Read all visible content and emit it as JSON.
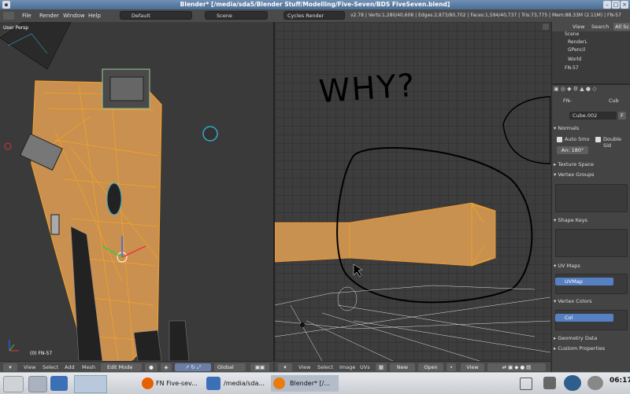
{
  "window": {
    "title": "Blender* [/media/sda5/Blender Stuff/Modelling/Five-Seven/BDS FiveSeven.blend]"
  },
  "topbar": {
    "menus": [
      "File",
      "Render",
      "Window",
      "Help"
    ],
    "layout": "Default",
    "scene": "Scene",
    "engine": "Cycles Render",
    "stats": "v2.78 | Verts:1,280/40,608 | Edges:2,873/80,702 | Faces:1,594/40,737 | Tris:73,775 | Mem:88.33M (2.11M) | FN-57"
  },
  "left_view": {
    "label_top": "User Persp",
    "label_bottom": "(0) FN-57",
    "header": {
      "menus": [
        "View",
        "Select",
        "Add",
        "Mesh"
      ],
      "mode": "Edit Mode",
      "pivot": "Global"
    }
  },
  "right_view": {
    "handwriting": "WHY?",
    "header": {
      "menus": [
        "View",
        "Select",
        "Image",
        "UVs"
      ],
      "new": "New",
      "open": "Open",
      "view": "View"
    }
  },
  "outliner": {
    "tabs": [
      "View",
      "Search",
      "All Sc"
    ],
    "items": [
      "Scene",
      "RenderL",
      "GPencil",
      "World",
      "FN-57"
    ]
  },
  "properties": {
    "object": "FN-",
    "object2": "Cub",
    "mesh_name": "Cube.002",
    "fake_user": "F",
    "normals": {
      "title": "Normals",
      "auto_smooth": "Auto Smo",
      "double_sided": "Double Sid",
      "angle": "An: 180°"
    },
    "texture_space": "Texture Space",
    "vertex_groups": "Vertex Groups",
    "shape_keys": "Shape Keys",
    "uv_maps": {
      "title": "UV Maps",
      "item": "UVMap"
    },
    "vertex_colors": {
      "title": "Vertex Colors",
      "item": "Col"
    },
    "geometry_data": "Geometry Data",
    "custom_properties": "Custom Properties"
  },
  "taskbar": {
    "tasks": [
      "FN Five-sev...",
      "/media/sda...",
      "Blender* [/..."
    ],
    "clock": "06:17"
  },
  "colors": {
    "accent": "#e8a040",
    "selected": "#5680c2",
    "title": "#5a7ba3"
  }
}
